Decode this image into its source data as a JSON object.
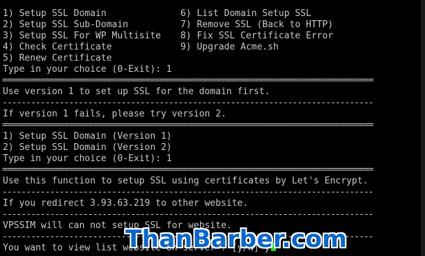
{
  "terminal": {
    "menu_main": {
      "left": [
        "1) Setup SSL Domain",
        "2) Setup SSL Sub-Domain",
        "3) Setup SSL For WP Multisite",
        "4) Check Certificate",
        "5) Renew Certificate"
      ],
      "right": [
        "6) List Domain Setup SSL",
        "7) Remove SSL (Back to HTTP)",
        "8) Fix SSL Certificate Error",
        "9) Upgrade Acme.sh"
      ],
      "prompt": "Type in your choice (0-Exit): 1"
    },
    "double_rule": "==============================================================================",
    "single_rule": "------------------------------------------------------------------------------",
    "note1": "Use version 1 to set up SSL for the domain first.",
    "note2": "If version 1 fails, please try version 2.",
    "menu_version": {
      "items": [
        "1) Setup SSL Domain (Version 1)",
        "2) Setup SSL Domain (Version 2)"
      ],
      "prompt": "Type in your choice (0-Exit): 1"
    },
    "info1": "Use this function to setup SSL using certificates by Let's Encrypt.",
    "info2": "If you redirect 3.93.63.219 to other website.",
    "info3": "VPSSIM will can not setup SSL for website.",
    "question": "You want to view list website on server ? [y/N] y"
  },
  "watermark": "ThanBarber.com",
  "colors": {
    "background": "#000000",
    "text": "#c9c9c9",
    "cursor": "#2ed02e",
    "watermark": "#0b66c9"
  }
}
